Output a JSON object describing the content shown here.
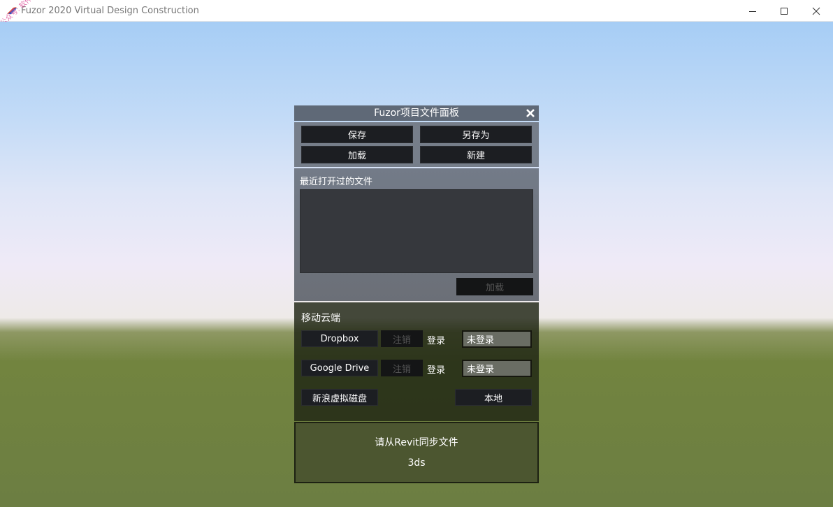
{
  "window": {
    "title": "Fuzor 2020 Virtual Design Construction",
    "watermark": "公众号: 软件智库"
  },
  "panel": {
    "title": "Fuzor项目文件面板",
    "buttons": {
      "save": "保存",
      "save_as": "另存为",
      "load": "加载",
      "new": "新建"
    },
    "recent": {
      "label": "最近打开过的文件",
      "files": [],
      "load_button": "加载"
    },
    "cloud": {
      "label": "移动云端",
      "providers": [
        {
          "name": "Dropbox",
          "logout": "注销",
          "login": "登录",
          "status": "未登录"
        },
        {
          "name": "Google Drive",
          "logout": "注销",
          "login": "登录",
          "status": "未登录"
        }
      ],
      "sina_disk": "新浪虚拟磁盘",
      "local": "本地"
    },
    "sync": {
      "message": "请从Revit同步文件",
      "format": "3ds"
    }
  }
}
